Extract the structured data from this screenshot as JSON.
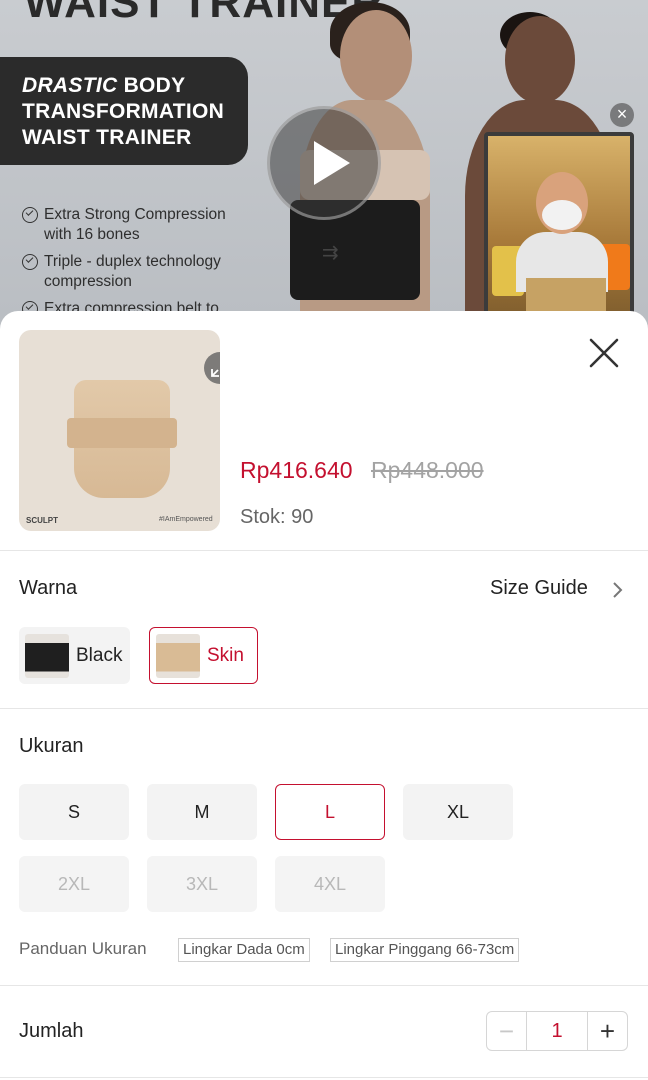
{
  "banner": {
    "headline": "WAIST TRAINER",
    "pill_line1_italic": "DRASTIC",
    "pill_line1_rest": " BODY",
    "pill_line2": "TRANSFORMATION",
    "pill_line3": "WAIST TRAINER",
    "features": [
      "Extra Strong Compression with 16 bones",
      "Triple - duplex technology compression",
      "Extra compression belt to"
    ]
  },
  "product": {
    "thumb_logo": "SCULPT",
    "thumb_tag": "#IAmEmpowered",
    "price_now": "Rp416.640",
    "price_old": "Rp448.000",
    "stock_label": "Stok: 90"
  },
  "color_section": {
    "title": "Warna",
    "size_guide_link": "Size Guide",
    "options": [
      {
        "label": "Black",
        "selected": false
      },
      {
        "label": "Skin",
        "selected": true
      }
    ]
  },
  "size_section": {
    "title": "Ukuran",
    "options": [
      {
        "label": "S",
        "state": "available"
      },
      {
        "label": "M",
        "state": "available"
      },
      {
        "label": "L",
        "state": "selected"
      },
      {
        "label": "XL",
        "state": "available"
      },
      {
        "label": "2XL",
        "state": "disabled"
      },
      {
        "label": "3XL",
        "state": "disabled"
      },
      {
        "label": "4XL",
        "state": "disabled"
      }
    ],
    "guide_label": "Panduan Ukuran",
    "guide_tags": [
      "Lingkar Dada 0cm",
      "Lingkar Pinggang 66-73cm"
    ]
  },
  "quantity": {
    "title": "Jumlah",
    "minus": "−",
    "value": "1",
    "plus": "+"
  },
  "colors": {
    "accent": "#c4102f",
    "muted_text": "#666666",
    "disabled_text": "#b8b8b8"
  }
}
